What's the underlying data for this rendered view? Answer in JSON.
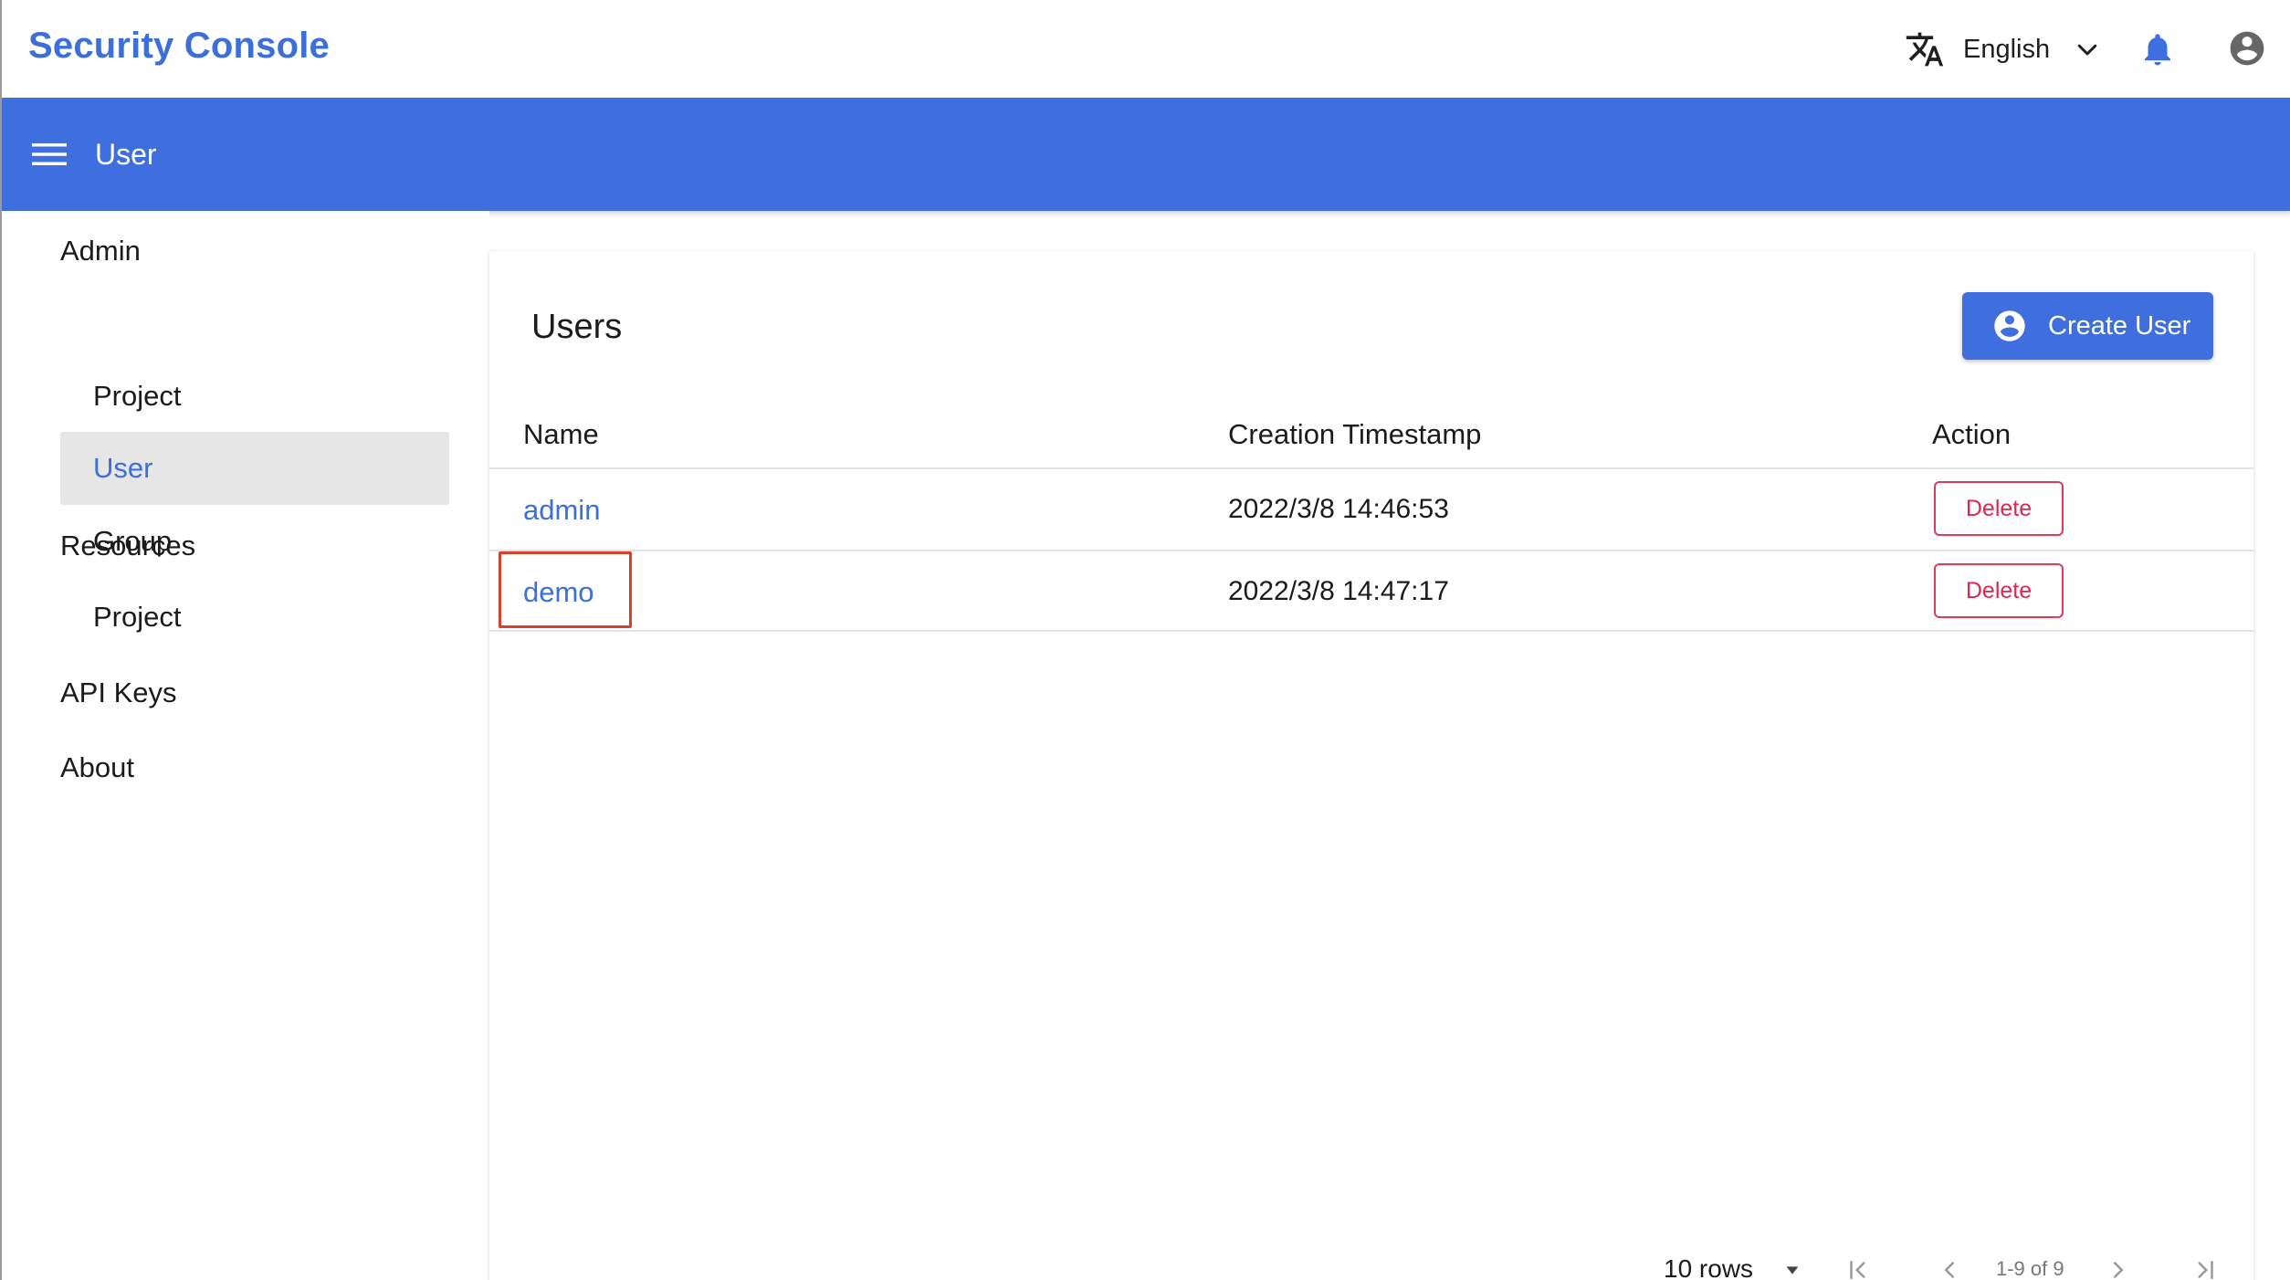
{
  "header": {
    "app_title": "Security Console",
    "language": "English"
  },
  "appbar": {
    "title": "User"
  },
  "sidebar": {
    "sections": [
      {
        "label": "Admin"
      },
      {
        "label": "Resources"
      },
      {
        "label": "API Keys"
      },
      {
        "label": "About"
      }
    ],
    "items": [
      {
        "label": "Project",
        "active": false
      },
      {
        "label": "User",
        "active": true
      },
      {
        "label": "Group",
        "active": false
      },
      {
        "label": "Project",
        "active": false
      }
    ]
  },
  "main": {
    "title": "Users",
    "create_label": "Create User",
    "columns": [
      "Name",
      "Creation Timestamp",
      "Action"
    ],
    "rows": [
      {
        "name": "admin",
        "created": "2022/3/8 14:46:53",
        "action": "Delete"
      },
      {
        "name": "demo",
        "created": "2022/3/8 14:47:17",
        "action": "Delete"
      }
    ]
  },
  "pagination": {
    "rows_per_page": "10 rows",
    "range": "1-9 of 9"
  },
  "icons": {
    "language": "translate-icon",
    "dropdown": "chevron-down-icon",
    "notifications": "bell-icon",
    "account": "account-circle-icon",
    "menu": "menu-icon",
    "create": "account-circle-icon"
  },
  "colors": {
    "brand_blue": "#3f6fde",
    "link_blue": "#3c6fd9",
    "danger": "#e0264f",
    "highlight": "#d9412e",
    "active_bg": "#e6e6e6"
  }
}
